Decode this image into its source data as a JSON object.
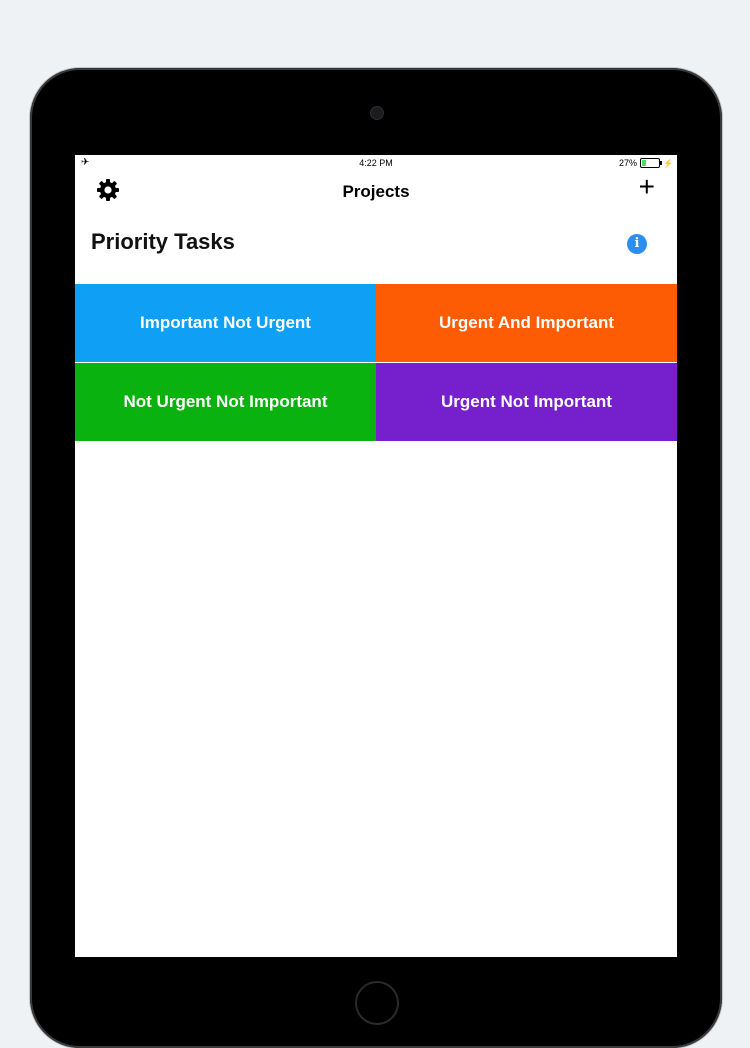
{
  "status_bar": {
    "airplane_icon": "✈",
    "time": "4:22 PM",
    "battery": "27%",
    "battery_level": 0.27,
    "charging_icon": "⚡"
  },
  "nav": {
    "title": "Projects",
    "settings_icon": "gear-icon",
    "add_icon": "+"
  },
  "header": {
    "title": "Priority Tasks",
    "info_icon": "i"
  },
  "quadrants": [
    {
      "label": "Important Not Urgent",
      "color": "#0fa0f5"
    },
    {
      "label": "Urgent And Important",
      "color": "#fd5c04"
    },
    {
      "label": "Not Urgent Not Important",
      "color": "#09b20e"
    },
    {
      "label": "Urgent Not Important",
      "color": "#7520cc"
    }
  ]
}
